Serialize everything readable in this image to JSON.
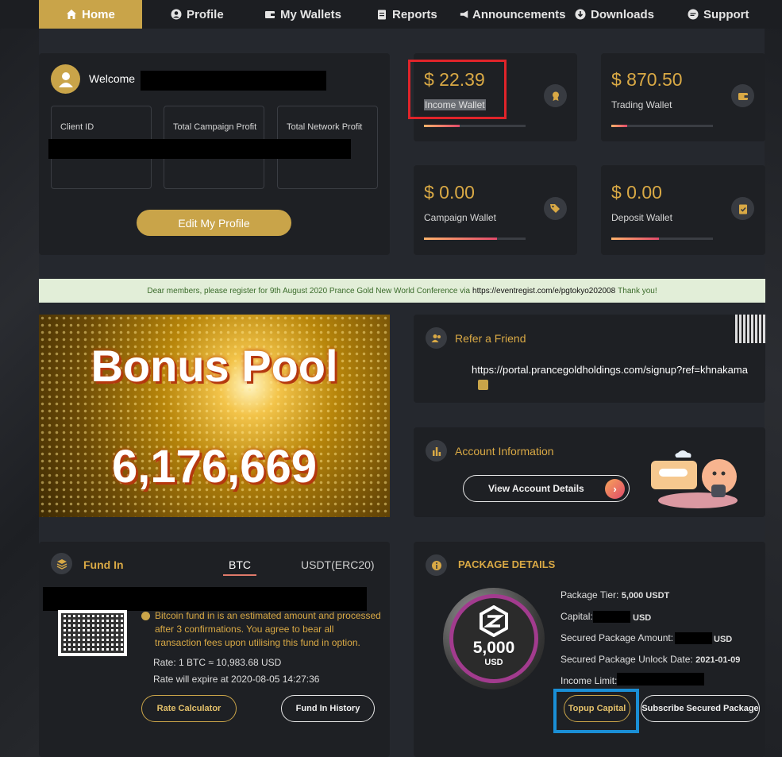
{
  "nav": {
    "items": [
      {
        "label": "Home"
      },
      {
        "label": "Profile"
      },
      {
        "label": "My Wallets"
      },
      {
        "label": "Reports"
      },
      {
        "label": "Announcements"
      },
      {
        "label": "Downloads"
      },
      {
        "label": "Support"
      }
    ]
  },
  "profile": {
    "welcome": "Welcome",
    "client_id_label": "Client ID",
    "campaign_profit_label": "Total Campaign Profit",
    "network_profit_label": "Total Network Profit",
    "edit_button": "Edit My Profile"
  },
  "wallets": {
    "income": {
      "amount": "$ 22.39",
      "label": "Income Wallet",
      "progress": 0.35
    },
    "trading": {
      "amount": "$ 870.50",
      "label": "Trading Wallet",
      "progress": 0.16
    },
    "campaign": {
      "amount": "$ 0.00",
      "label": "Campaign Wallet",
      "progress": 0.72
    },
    "deposit": {
      "amount": "$ 0.00",
      "label": "Deposit Wallet",
      "progress": 0.47
    }
  },
  "banner": {
    "text_before": "Dear members, please register for 9th August 2020 Prance Gold New World Conference via",
    "link": "https://eventregist.com/e/pgtokyo202008",
    "text_after": "Thank you!"
  },
  "bonus_pool": {
    "title": "Bonus Pool",
    "amount": "6,176,669"
  },
  "refer": {
    "title": "Refer a Friend",
    "url": "https://portal.prancegoldholdings.com/signup?ref=khnakama"
  },
  "account": {
    "title": "Account Information",
    "button": "View Account Details"
  },
  "fund_in": {
    "title": "Fund In",
    "tabs": [
      "BTC",
      "USDT(ERC20)"
    ],
    "note": "Bitcoin fund in is an estimated amount and processed after 3 confirmations. You agree to bear all transaction fees upon utilising this fund in option.",
    "rate": "Rate: 1 BTC ≈ 10,983.68 USD",
    "expiry": "Rate will expire at 2020-08-05 14:27:36",
    "rate_calc_button": "Rate Calculator",
    "history_button": "Fund In History"
  },
  "package": {
    "title": "PACKAGE DETAILS",
    "badge_amount": "5,000",
    "badge_unit": "USD",
    "tier_label": "Package Tier:",
    "tier_value": "5,000 USDT",
    "capital_label": "Capital:",
    "capital_unit": "USD",
    "secured_label": "Secured Package Amount:",
    "secured_unit": "USD",
    "unlock_label": "Secured Package Unlock Date:",
    "unlock_value": "2021-01-09",
    "income_limit_label": "Income Limit:",
    "topup_button": "Topup Capital",
    "subscribe_button": "Subscribe Secured Package"
  },
  "colors": {
    "accent": "#c9a449",
    "highlight_red": "#e0242a",
    "highlight_blue": "#1a8fd6"
  }
}
